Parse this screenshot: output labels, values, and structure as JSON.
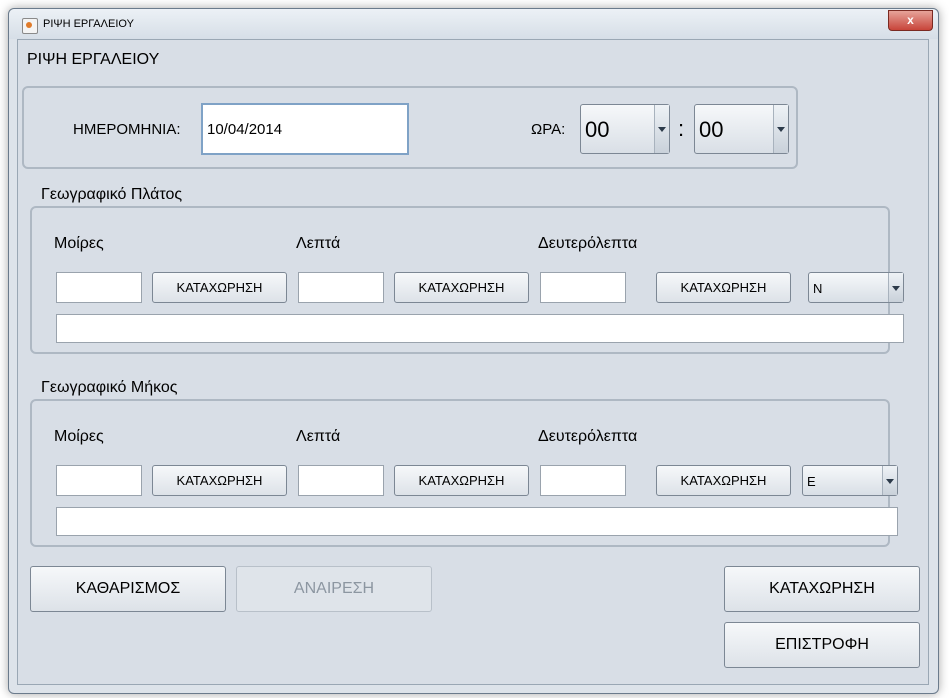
{
  "window": {
    "title": "ΡΙΨΗ ΕΡΓΑΛΕΙΟΥ",
    "close_label": "x"
  },
  "header": {
    "title": "ΡΙΨΗ ΕΡΓΑΛΕΙΟΥ"
  },
  "datetime": {
    "date_label": "ΗΜΕΡΟΜΗΝΙΑ:",
    "date_value": "10/04/2014",
    "time_label": "ΩΡΑ:",
    "hour_value": "00",
    "separator": ":",
    "minute_value": "00"
  },
  "latitude": {
    "title": "Γεωγραφικό Πλάτος",
    "degrees_label": "Μοίρες",
    "minutes_label": "Λεπτά",
    "seconds_label": "Δευτερόλεπτα",
    "degrees_value": "",
    "minutes_value": "",
    "seconds_value": "",
    "register_label": "ΚΑΤΑΧΩΡΗΣΗ",
    "direction": "N",
    "result_value": ""
  },
  "longitude": {
    "title": "Γεωγραφικό Μήκος",
    "degrees_label": "Μοίρες",
    "minutes_label": "Λεπτά",
    "seconds_label": "Δευτερόλεπτα",
    "degrees_value": "",
    "minutes_value": "",
    "seconds_value": "",
    "register_label": "ΚΑΤΑΧΩΡΗΣΗ",
    "direction": "E",
    "result_value": ""
  },
  "actions": {
    "clear_label": "ΚΑΘΑΡΙΣΜΟΣ",
    "undo_label": "ΑΝΑΙΡΕΣΗ",
    "save_label": "ΚΑΤΑΧΩΡΗΣΗ",
    "back_label": "ΕΠΙΣΤΡΟΦΗ"
  },
  "icons": {
    "app": "java-cup-icon",
    "dropdown": "chevron-down-icon"
  }
}
